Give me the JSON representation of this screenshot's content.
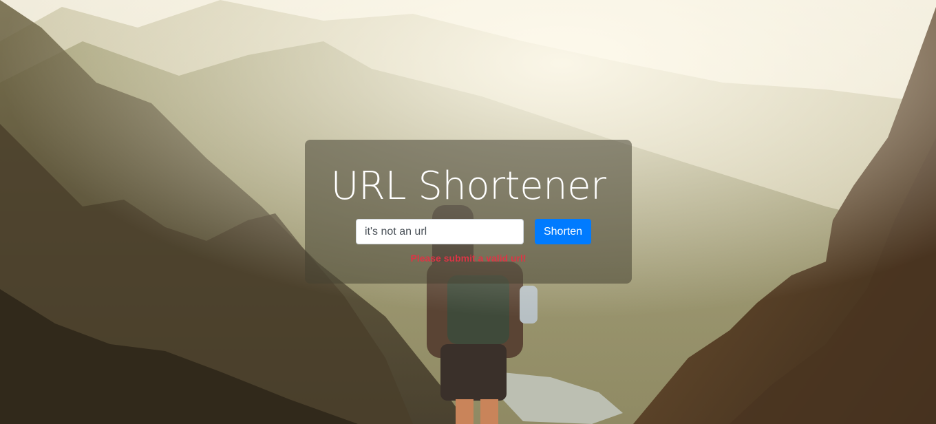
{
  "page": {
    "title": "URL Shortener"
  },
  "form": {
    "input_value": "it's not an url",
    "button_label": "Shorten",
    "error_message": "Please submit a valid url!"
  },
  "colors": {
    "button_bg": "#007bff",
    "error_text": "#dc3545",
    "panel_bg": "rgba(70,66,50,0.55)"
  }
}
